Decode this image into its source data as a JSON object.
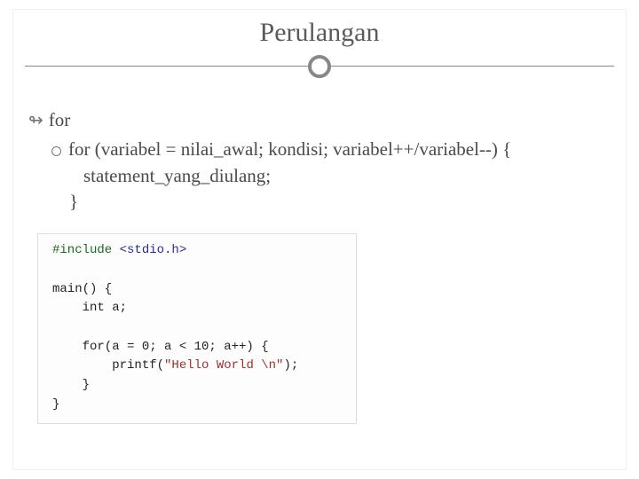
{
  "title": "Perulangan",
  "bullet1": "for",
  "bullet2": "for (variabel = nilai_awal; kondisi; variabel++/variabel--) {",
  "bullet2_line2": "statement_yang_diulang;",
  "bullet2_line3": "}",
  "code": {
    "l1a": "#include ",
    "l1b": "<stdio.h>",
    "l2": "",
    "l3": "main() {",
    "l4": "    int a;",
    "l5": "",
    "l6": "    for(a = 0; a < 10; a++) {",
    "l7a": "        printf(",
    "l7b": "\"Hello World \\n\"",
    "l7c": ");",
    "l8": "    }",
    "l9": "}"
  }
}
